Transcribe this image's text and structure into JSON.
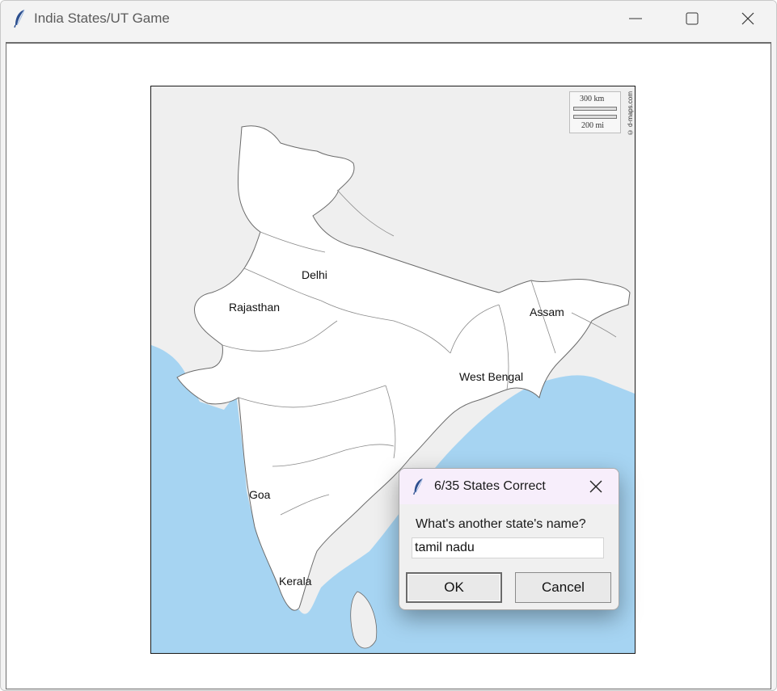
{
  "window": {
    "title": "India States/UT Game",
    "icon": "feather-icon",
    "controls": [
      "minimize-icon",
      "maximize-icon",
      "close-icon"
    ]
  },
  "map": {
    "labels": {
      "delhi": "Delhi",
      "rajasthan": "Rajasthan",
      "assam": "Assam",
      "west_bengal": "West Bengal",
      "goa": "Goa",
      "kerala": "Kerala"
    },
    "scale_km": "300 km",
    "scale_mi": "200 mi",
    "credit": "© d-maps.com",
    "colors": {
      "land": "#ffffff",
      "neighbors": "#efefef",
      "sea": "#a6d4f2",
      "border": "#6b6b6b"
    }
  },
  "dialog": {
    "title": "6/35 States Correct",
    "prompt": "What's another state's name?",
    "input_value": "tamil nadu",
    "ok_label": "OK",
    "cancel_label": "Cancel"
  }
}
